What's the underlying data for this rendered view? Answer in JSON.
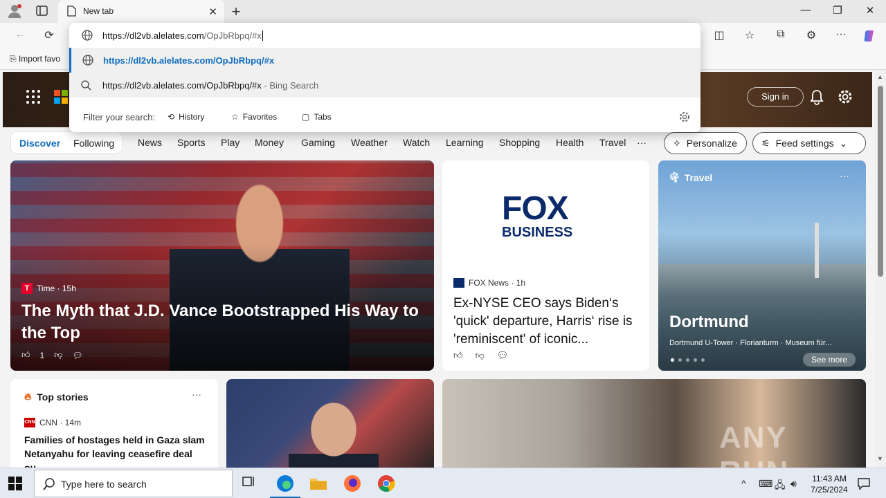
{
  "browser": {
    "tab_title": "New tab",
    "bookmark_label": "Import favo",
    "address_value": "https://dl2vb.alelates.com/OpJbRbpq/#x",
    "address_host": "https://dl2vb.alelates.com",
    "address_path": "/OpJbRbpq/#x"
  },
  "omnibox": {
    "suggestion_url": "https://dl2vb.alelates.com/OpJbRbpq/#x",
    "suggestion_search": "https://dl2vb.alelates.com/OpJbRbpq/#x",
    "suggestion_search_suffix": " - Bing Search",
    "filter_label": "Filter your search:",
    "filter_history": "History",
    "filter_favorites": "Favorites",
    "filter_tabs": "Tabs"
  },
  "newtab": {
    "sign_in": "Sign in",
    "nav": {
      "discover": "Discover",
      "following": "Following",
      "links": [
        "News",
        "Sports",
        "Play",
        "Money",
        "Gaming",
        "Weather",
        "Watch",
        "Learning",
        "Shopping",
        "Health",
        "Travel"
      ],
      "more": "···",
      "personalize": "Personalize",
      "feed_settings": "Feed settings"
    },
    "card_main": {
      "source": "Time · 15h",
      "headline": "The Myth that J.D. Vance Bootstrapped His Way to the Top",
      "likes": "1"
    },
    "card_fox": {
      "logo_line1": "FOX",
      "logo_line2": "BUSINESS",
      "source": "FOX News · 1h",
      "headline": "Ex-NYSE CEO says Biden‘s 'quick' departure, Harris‘ rise is 'reminiscent' of iconic..."
    },
    "card_travel": {
      "tag": "Travel",
      "title": "Dortmund",
      "subtitle": "Dortmund U-Tower · Florianturm · Museum für...",
      "see_more": "See more",
      "more": "···"
    },
    "top_stories": {
      "title": "Top stories",
      "more": "···",
      "source": "CNN · 14m",
      "headline": "Families of hostages held in Gaza slam Netanyahu for leaving ceasefire deal ou..."
    },
    "watermark": "ANY RUN"
  },
  "taskbar": {
    "search_placeholder": "Type here to search",
    "time": "11:43 AM",
    "date": "7/25/2024"
  },
  "colors": {
    "accent": "#0f6cbd",
    "fox_blue": "#0b2a6b",
    "fox_red": "#c8102e"
  }
}
